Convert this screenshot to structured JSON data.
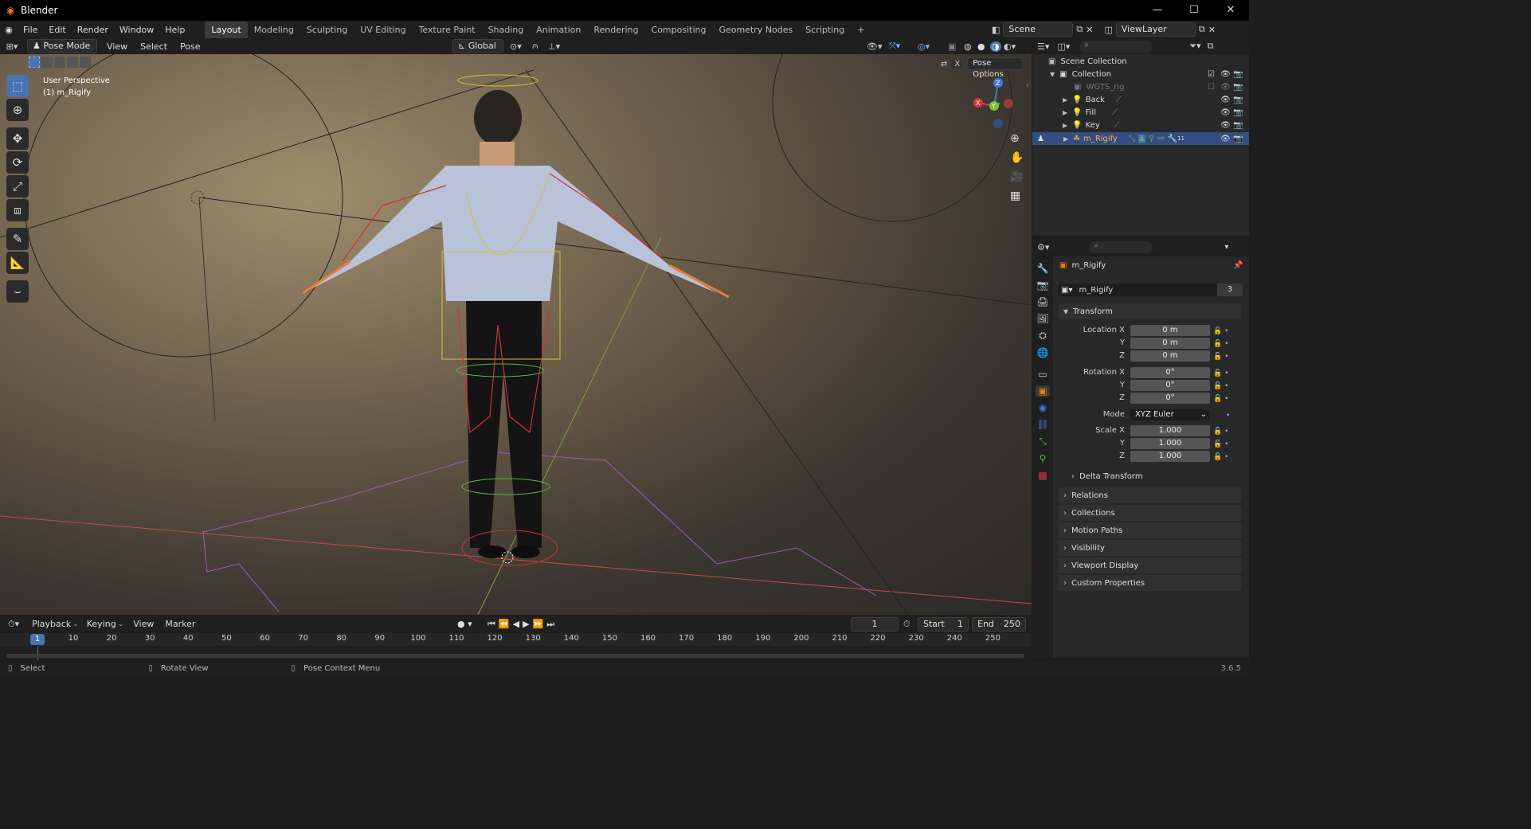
{
  "app": {
    "title": "Blender",
    "version": "3.6.5"
  },
  "window_controls": {
    "minimize": "—",
    "maximize": "☐",
    "close": "✕"
  },
  "menubar": {
    "items": [
      "File",
      "Edit",
      "Render",
      "Window",
      "Help"
    ]
  },
  "workspaces": [
    "Layout",
    "Modeling",
    "Sculpting",
    "UV Editing",
    "Texture Paint",
    "Shading",
    "Animation",
    "Rendering",
    "Compositing",
    "Geometry Nodes",
    "Scripting"
  ],
  "active_workspace": "Layout",
  "add_workspace": "+",
  "scene": {
    "name": "Scene"
  },
  "view_layer": {
    "name": "ViewLayer"
  },
  "viewport_header": {
    "mode": "Pose Mode",
    "menus": [
      "View",
      "Select",
      "Pose"
    ],
    "transform_orientation": "Global",
    "pose_options": "Pose Options"
  },
  "viewport": {
    "perspective": "User Perspective",
    "object": "(1) m_Rigify"
  },
  "gizmo": {
    "x": "X",
    "y": "Y",
    "z": "Z"
  },
  "outliner": {
    "scene_collection": "Scene Collection",
    "collection": "Collection",
    "items": [
      {
        "name": "WGTS_rig",
        "dim": true
      },
      {
        "name": "Back"
      },
      {
        "name": "Fill"
      },
      {
        "name": "Key"
      },
      {
        "name": "m_Rigify",
        "selected": true,
        "badge": "11"
      }
    ]
  },
  "properties": {
    "object_name": "m_Rigify",
    "datablock": "m_Rigify",
    "users": "3",
    "transform_header": "Transform",
    "location": {
      "label": "Location X",
      "x": "0 m",
      "y": "0 m",
      "z": "0 m"
    },
    "rotation": {
      "label": "Rotation X",
      "x": "0°",
      "y": "0°",
      "z": "0°"
    },
    "mode_label": "Mode",
    "mode_value": "XYZ Euler",
    "scale": {
      "label": "Scale X",
      "x": "1.000",
      "y": "1.000",
      "z": "1.000"
    },
    "axis_y": "Y",
    "axis_z": "Z",
    "delta_transform": "Delta Transform",
    "panels": [
      "Relations",
      "Collections",
      "Motion Paths",
      "Visibility",
      "Viewport Display",
      "Custom Properties"
    ]
  },
  "timeline": {
    "menus": [
      "Playback",
      "Keying",
      "View",
      "Marker"
    ],
    "current_frame": "1",
    "start_label": "Start",
    "start": "1",
    "end_label": "End",
    "end": "250",
    "ticks": [
      "10",
      "20",
      "30",
      "40",
      "50",
      "60",
      "70",
      "80",
      "90",
      "100",
      "110",
      "120",
      "130",
      "140",
      "150",
      "160",
      "170",
      "180",
      "190",
      "200",
      "210",
      "220",
      "230",
      "240",
      "250"
    ],
    "playhead": "1"
  },
  "statusbar": {
    "select": "Select",
    "rotate": "Rotate View",
    "context": "Pose Context Menu"
  },
  "colors": {
    "accent": "#4772b3",
    "background": "#1d1d1d",
    "panel": "#282828",
    "x_axis": "#d4393f",
    "y_axis": "#7cc036",
    "z_axis": "#3b7be0"
  }
}
